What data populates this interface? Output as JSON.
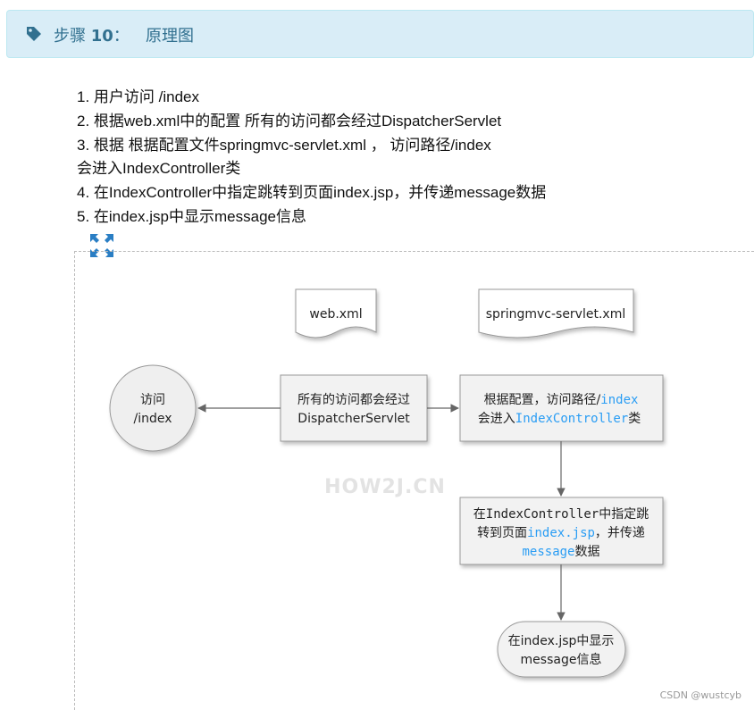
{
  "header": {
    "step_prefix": "步骤",
    "step_number": "10",
    "step_separator": "：",
    "title": "原理图",
    "icon": "tag-icon"
  },
  "steps": [
    "1. 用户访问 /index",
    "2. 根据web.xml中的配置 所有的访问都会经过DispatcherServlet",
    "3. 根据 根据配置文件springmvc-servlet.xml ， 访问路径/index",
    "会进入IndexController类",
    "4. 在IndexController中指定跳转到页面index.jsp，并传递message数据",
    "5. 在index.jsp中显示message信息"
  ],
  "expand_icon": "expand-icon",
  "diagram": {
    "doc_web_xml": "web.xml",
    "doc_springmvc": "springmvc-servlet.xml",
    "visit_line1": "访问",
    "visit_line2": "/index",
    "dispatcher_line1": "所有的访问都会经过",
    "dispatcher_line2": "DispatcherServlet",
    "config_a": "根据配置，访问路径/",
    "config_b": "index",
    "config_c": "会进入",
    "config_d": "IndexController",
    "config_e": "类",
    "controller_a": "在",
    "controller_b": "IndexController",
    "controller_c": "中指定跳",
    "controller_d": "转到页面",
    "controller_e": "index.jsp",
    "controller_f": "，并传递",
    "controller_g": "message",
    "controller_h": "数据",
    "jsp_line1": "在index.jsp中显示",
    "jsp_line2": "message信息",
    "watermark": "HOW2J.CN"
  },
  "credit": "CSDN @wustcyb",
  "colors": {
    "header_bg": "#d9edf7",
    "header_text": "#31708f",
    "code_blue": "#2a9df4"
  }
}
